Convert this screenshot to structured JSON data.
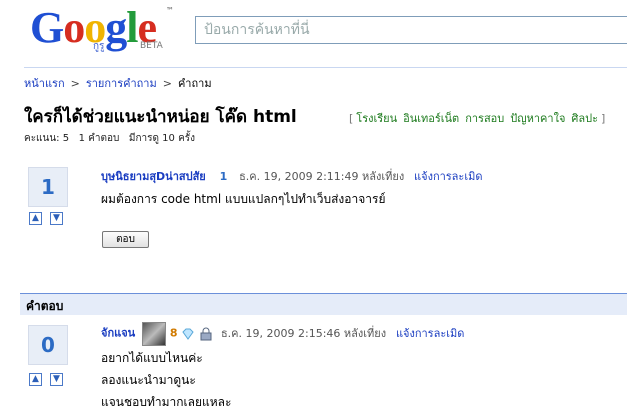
{
  "header": {
    "logo_text": "Google",
    "logo_sub": "กูรู",
    "logo_beta": "BETA",
    "logo_tm": "™",
    "search_placeholder": "ป้อนการค้นหาที่นี่"
  },
  "breadcrumb": {
    "home": "หน้าแรก",
    "list": "รายการคำถาม",
    "current": "คำถาม",
    "sep": ">"
  },
  "question": {
    "title": "ใครก็ได้ช่วยแนะนำหน่อย โค๊ด html",
    "categories": [
      "โรงเรียน",
      "อินเทอร์เน็ต",
      "การสอบ",
      "ปัญหาคาใจ",
      "ศิลปะ"
    ],
    "meta": "คะแนน: 5   1 คำตอบ   มีการดู 10 ครั้ง",
    "votes": "1",
    "author": "บุษนิธยามสุDน่าสปสัย",
    "level": "1",
    "date": "ธ.ค. 19, 2009 2:11:49 หลังเที่ยง",
    "report": "แจ้งการละเมิด",
    "body": "ผมต้องการ code html แบบแปลกๆไปทำเว็บส่งอาจารย์",
    "reply_button": "ตอบ"
  },
  "answers": {
    "heading": "คำตอบ",
    "items": [
      {
        "votes": "0",
        "author": "จักแจน",
        "level": "8",
        "date": "ธ.ค. 19, 2009 2:15:46 หลังเที่ยง",
        "report": "แจ้งการละเมิด",
        "lines": [
          "อยากได้แบบไหนค่ะ",
          "ลองแนะนำมาดูนะ",
          "แจนชอบทำมากเลยแหละ"
        ]
      }
    ]
  },
  "colors": {
    "link": "#1a3dc1",
    "category": "#1c7a1c",
    "vote_bg": "#e8eef7",
    "answers_bar": "#e5ecf9"
  },
  "icons": [
    "up-arrow-icon",
    "down-arrow-icon",
    "diamond-icon",
    "lock-icon",
    "user-icon"
  ]
}
